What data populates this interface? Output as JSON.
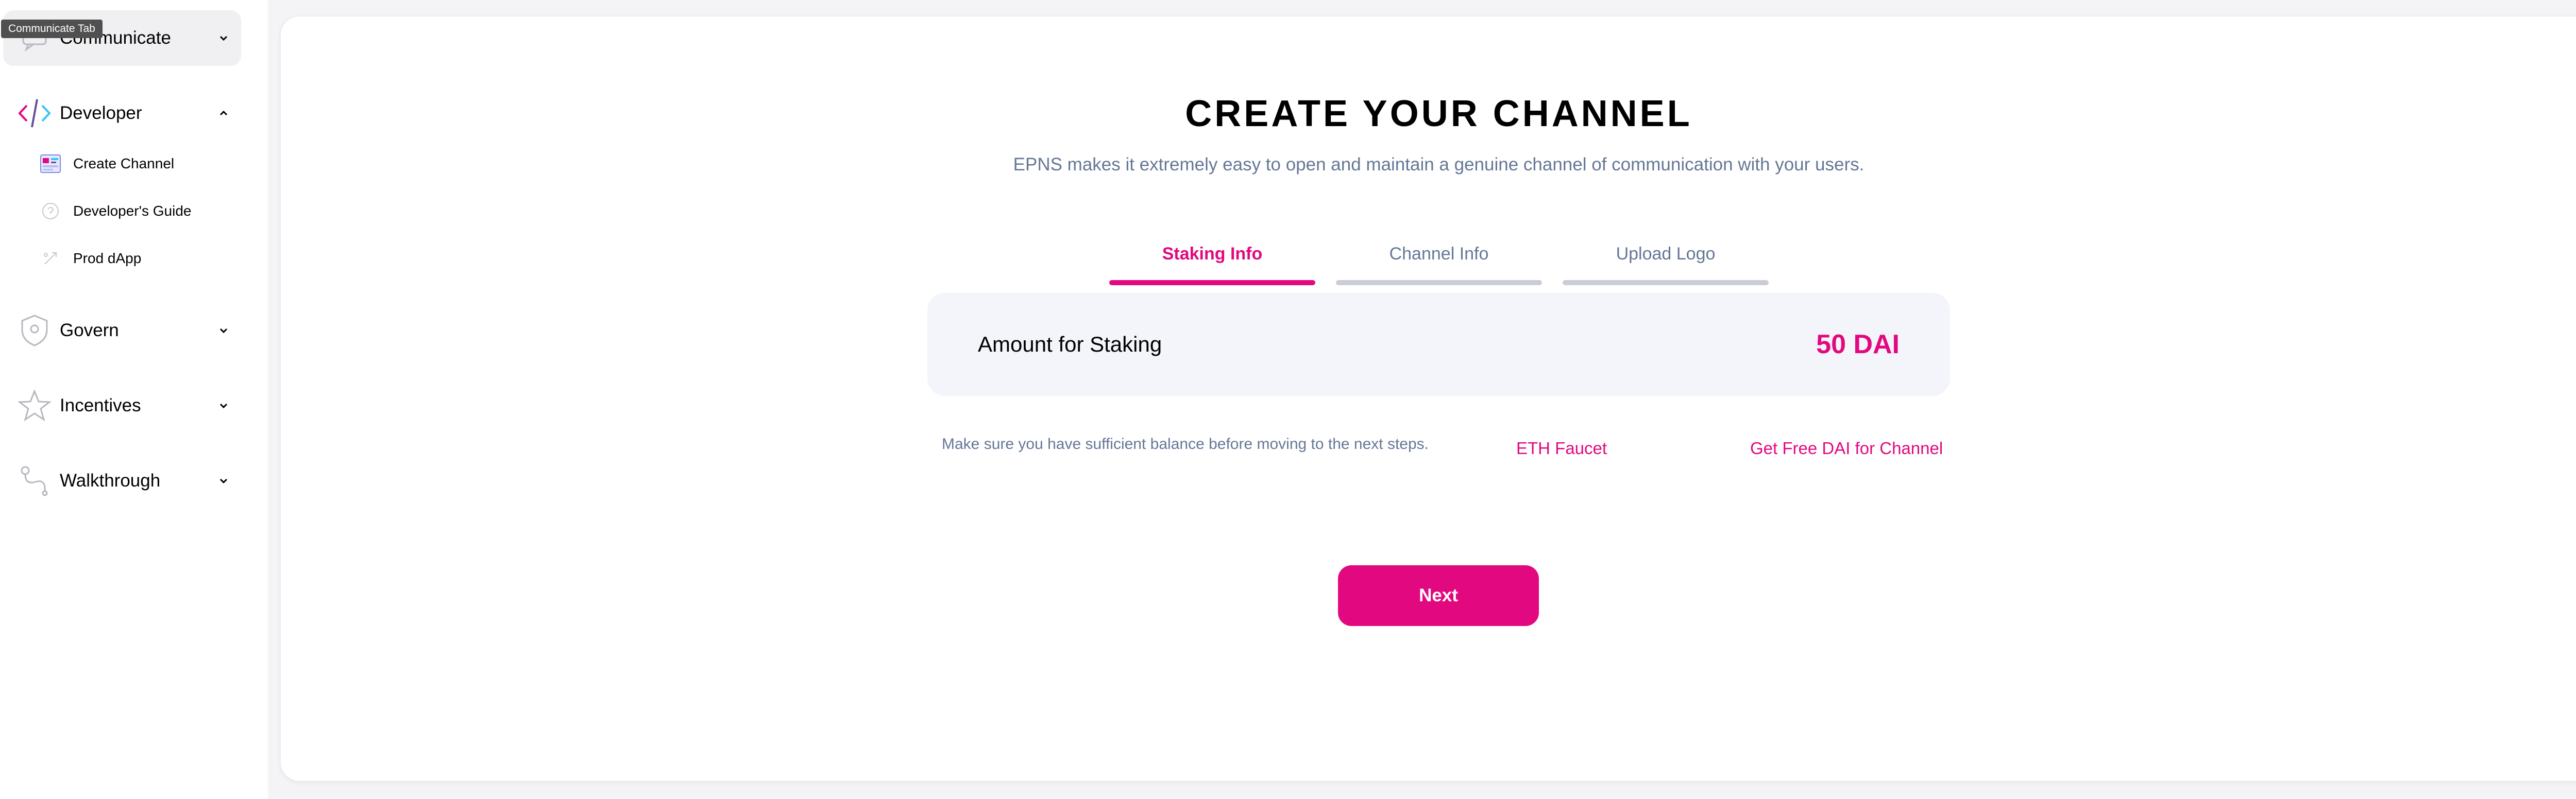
{
  "tooltip": "Communicate Tab",
  "sidebar": {
    "sections": [
      {
        "label": "Communicate",
        "icon": "chat-icon",
        "expanded": false
      },
      {
        "label": "Developer",
        "icon": "code-icon",
        "expanded": true
      },
      {
        "label": "Govern",
        "icon": "shield-icon",
        "expanded": false
      },
      {
        "label": "Incentives",
        "icon": "star-icon",
        "expanded": false
      },
      {
        "label": "Walkthrough",
        "icon": "path-icon",
        "expanded": false
      }
    ],
    "developer_items": [
      {
        "label": "Create Channel",
        "icon": "create-channel-icon"
      },
      {
        "label": "Developer's Guide",
        "icon": "guide-icon"
      },
      {
        "label": "Prod dApp",
        "icon": "prod-dapp-icon"
      }
    ]
  },
  "main": {
    "title": "CREATE YOUR CHANNEL",
    "subtitle": "EPNS makes it extremely easy to open and maintain a genuine channel of communication with your users.",
    "tabs": [
      {
        "label": "Staking Info",
        "active": true
      },
      {
        "label": "Channel Info",
        "active": false
      },
      {
        "label": "Upload Logo",
        "active": false
      }
    ],
    "staking": {
      "label": "Amount for Staking",
      "value": "50 DAI"
    },
    "note": "Make sure you have sufficient balance before moving to the next steps.",
    "links": {
      "faucet": "ETH Faucet",
      "free_dai": "Get Free DAI for Channel"
    },
    "next_label": "Next"
  },
  "colors": {
    "accent": "#e20880",
    "muted_text": "#657795",
    "inactive_tab": "#c9ced6",
    "card_bg": "#ffffff",
    "page_bg": "#f4f4f6"
  }
}
